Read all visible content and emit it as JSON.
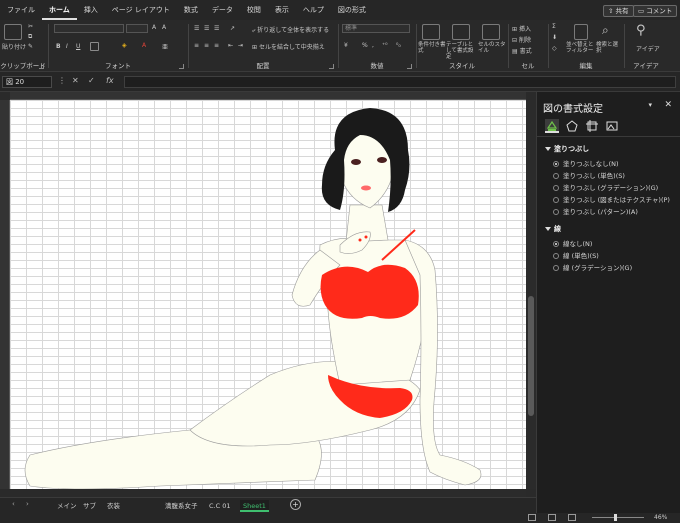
{
  "menu": {
    "tabs": [
      "ファイル",
      "ホーム",
      "挿入",
      "ページ レイアウト",
      "数式",
      "データ",
      "校閲",
      "表示",
      "ヘルプ",
      "図の形式"
    ],
    "active_tab": "ホーム",
    "share_label": "共有",
    "comment_label": "コメント"
  },
  "ribbon": {
    "clipboard": {
      "paste_label": "貼り付け",
      "group_label": "クリップボード"
    },
    "font": {
      "font_name": "",
      "font_size": "",
      "bold": "B",
      "italic": "I",
      "underline": "U",
      "group_label": "フォント"
    },
    "alignment": {
      "wrap_text": "折り返して全体を表示する",
      "merge_center": "セルを結合して中央揃え",
      "group_label": "配置"
    },
    "number": {
      "format": "標準",
      "group_label": "数値"
    },
    "styles": {
      "conditional": "条件付き書式",
      "table": "テーブルとして書式設定",
      "cell_styles": "セルのスタイル",
      "group_label": "スタイル"
    },
    "cells": {
      "insert": "挿入",
      "delete": "削除",
      "format": "書式",
      "group_label": "セル"
    },
    "editing": {
      "sort_filter": "並べ替えとフィルター",
      "find_select": "検索と選択",
      "group_label": "編集"
    },
    "ideas": {
      "label": "アイデア",
      "group_label": "アイデア"
    }
  },
  "formula_bar": {
    "name_box": "図 20",
    "cancel": "✕",
    "confirm": "✓",
    "fx": "fx",
    "value": ""
  },
  "sheet_tabs": {
    "tabs": [
      "メイン",
      "サブ",
      "衣装",
      "満腹系女子",
      "C.C 01",
      "Sheet1"
    ],
    "active": "Sheet1"
  },
  "status_bar": {
    "zoom": "46%"
  },
  "format_pane": {
    "title": "図の書式設定",
    "fill_section": "塗りつぶし",
    "fill_options": [
      "塗りつぶしなし(N)",
      "塗りつぶし (単色)(S)",
      "塗りつぶし (グラデーション)(G)",
      "塗りつぶし (図またはテクスチャ)(P)",
      "塗りつぶし (パターン)(A)"
    ],
    "fill_selected": 0,
    "line_section": "線",
    "line_options": [
      "線なし(N)",
      "線 (単色)(S)",
      "線 (グラデーション)(G)"
    ],
    "line_selected": 0
  },
  "colors": {
    "bikini_red": "#ff2a1a",
    "skin": "#fdfdf0",
    "hair": "#1a1a1a"
  }
}
